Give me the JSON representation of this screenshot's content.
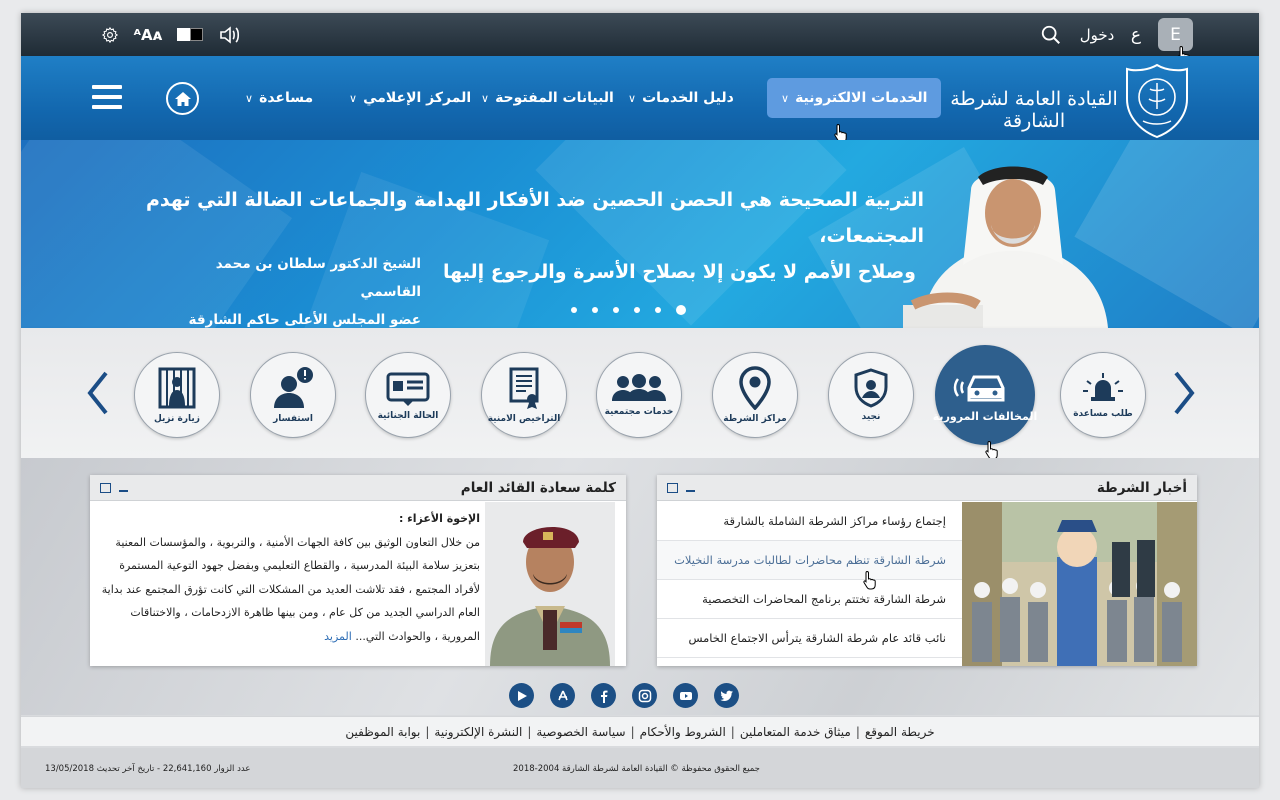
{
  "topbar": {
    "lang_label": "E",
    "arabic_letter": "ع",
    "login_label": "دخول",
    "font_size_label": "ᴬAᴀ",
    "icons": [
      "settings-icon",
      "text-size-icon",
      "contrast-icon",
      "sound-icon",
      "search-icon"
    ]
  },
  "nav": {
    "logo_text": "القيادة العامة لشرطة الشارقة",
    "items": [
      {
        "label": "الخدمات الالكترونية",
        "active": true
      },
      {
        "label": "دليل الخدمات"
      },
      {
        "label": "البيانات المفتوحة"
      },
      {
        "label": "المركز الإعلامي"
      },
      {
        "label": "مساعدة"
      }
    ]
  },
  "hero": {
    "quote_line1": "التربية الصحيحة هي الحصن الحصين ضد الأفكار الهدامة والجماعات الضالة التي تهدم المجتمعات،",
    "quote_line2": "وصلاح الأمم لا يكون إلا بصلاح الأسرة والرجوع إليها",
    "attribution_name": "الشيخ الدكتور سلطان بن محمد القاسمي",
    "attribution_title": "عضو المجلس الأعلى حاكم الشارقة",
    "slide_count": 6,
    "active_slide": 6
  },
  "services": [
    {
      "label": "طلب مساعدة",
      "icon": "alarm-icon"
    },
    {
      "label": "المخالفات المرورية",
      "icon": "car-icon",
      "active": true
    },
    {
      "label": "نجيد",
      "icon": "shield-icon"
    },
    {
      "label": "مراكز الشرطة",
      "icon": "location-pin-icon"
    },
    {
      "label": "خدمات مجتمعية",
      "icon": "community-icon"
    },
    {
      "label": "التراخيص الامنية",
      "icon": "certificate-icon"
    },
    {
      "label": "الحالة الجنائية",
      "icon": "id-card-icon"
    },
    {
      "label": "استفسار",
      "icon": "inquiry-icon"
    },
    {
      "label": "زيارة نزيل",
      "icon": "jail-icon"
    }
  ],
  "news_panel": {
    "title": "أخبار الشرطة",
    "items": [
      "إجتماع  رؤساء مراكز الشرطة الشاملة بالشارقة",
      "شرطة الشارقة تنظم محاضرات لطالبات مدرسة النخيلات",
      "شرطة الشارقة تختتم برنامج المحاضرات التخصصية",
      "نائب قائد عام شرطة الشارقة يترأس الاجتماع الخامس"
    ]
  },
  "chief_panel": {
    "title": "كلمة سعادة القائد العام",
    "greeting": "الإخوة الأعزاء :",
    "body": "من خلال التعاون الوثيق بين كافة الجهات الأمنية ، والتربوية ، والمؤسسات المعنية بتعزيز سلامة البيئة المدرسية ، والقطاع التعليمي  وبفضل جهود التوعية المستمرة لأفراد المجتمع ، فقد تلاشت العديد من المشكلات التي كانت تؤرق المجتمع عند بداية العام الدراسي الجديد من كل عام ، ومن بينها ظاهرة الازدحامات ، والاختناقات المرورية ، والحوادث التي...",
    "more_label": "المزيد"
  },
  "social": [
    "google-play-icon",
    "app-store-icon",
    "facebook-icon",
    "instagram-icon",
    "youtube-icon",
    "twitter-icon"
  ],
  "footer": {
    "links": [
      "خريطة الموقع",
      "ميثاق خدمة المتعاملين",
      "الشروط والأحكام",
      "سياسة الخصوصية",
      "النشرة الإلكترونية",
      "بوابة الموظفين"
    ],
    "separator": "|",
    "copyright": "جميع الحقوق محفوظة © القيادة العامة لشرطة الشارقة 2004-2018",
    "visitors": "عدد الزوار 22,641,160 - تاريخ آخر تحديث 13/05/2018"
  }
}
